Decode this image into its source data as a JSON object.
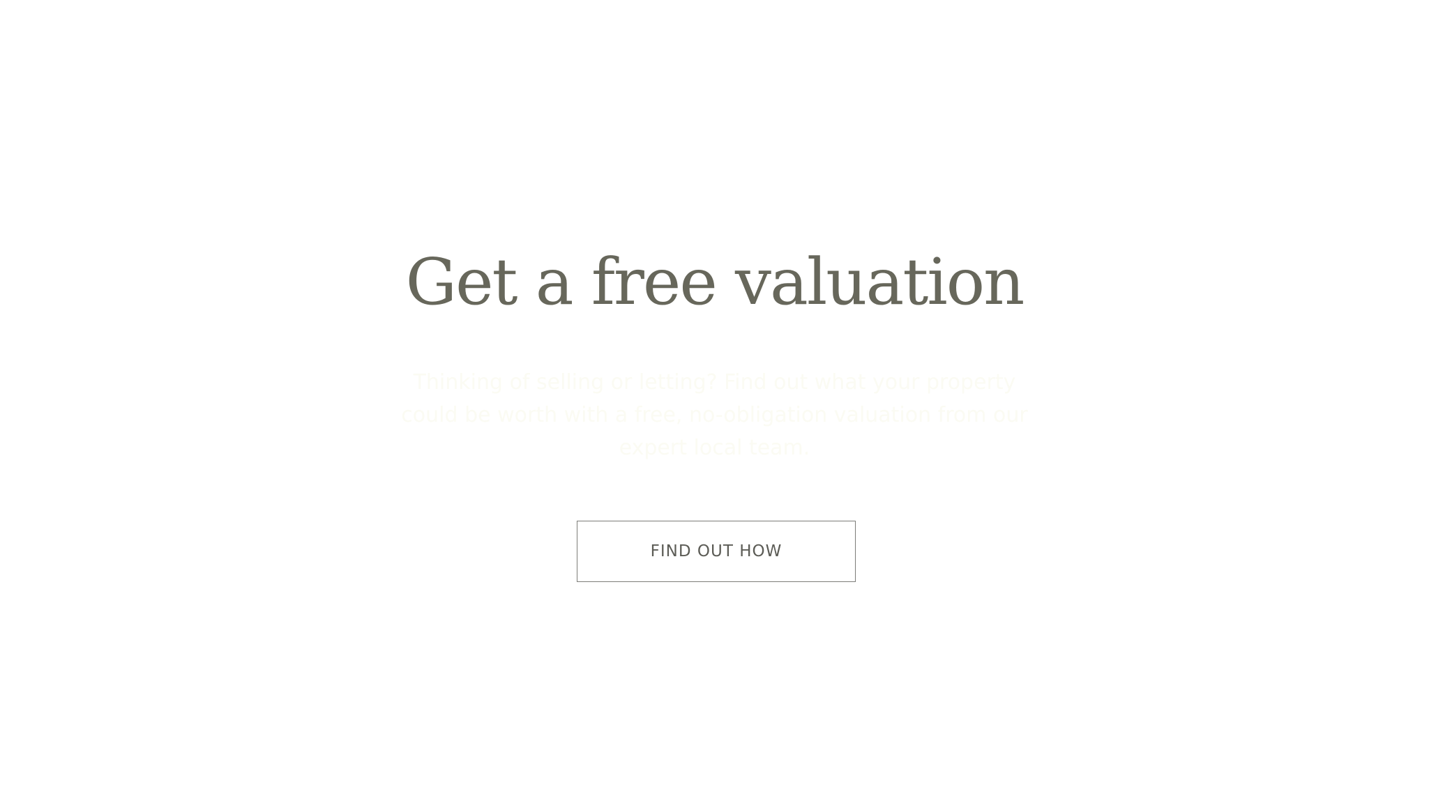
{
  "hero": {
    "title": "Get a free valuation",
    "subtitle": "Thinking of selling or letting? Find out what your property could be worth with a free, no-obligation valuation from our expert local team.",
    "cta_label": "FIND OUT HOW"
  },
  "colors": {
    "background": "#ffffff",
    "title": "#67675b",
    "subtitle": "#fbfbf3",
    "button_border": "#7c7c78",
    "button_text": "#5c5c56"
  }
}
